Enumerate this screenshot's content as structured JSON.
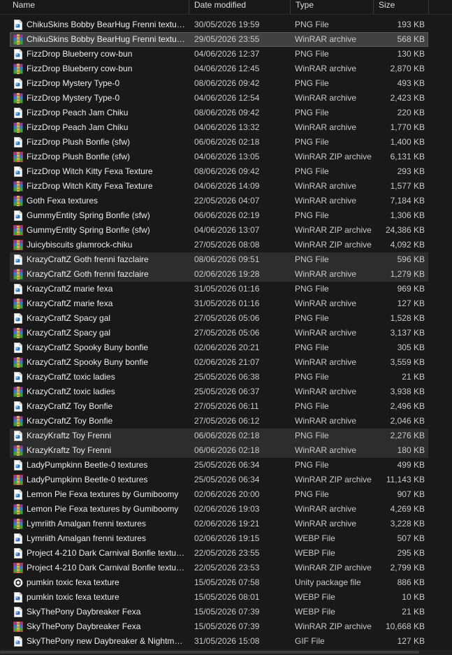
{
  "columns": {
    "name": "Name",
    "date": "Date modified",
    "type": "Type",
    "size": "Size"
  },
  "files": [
    {
      "name": "ChikuSkins Bobby BearHug Frenni textures",
      "date": "30/05/2026 19:59",
      "type": "PNG File",
      "size": "193 KB",
      "icon": "png-file-icon"
    },
    {
      "name": "ChikuSkins Bobby BearHug Frenni textures",
      "date": "29/05/2026 23:55",
      "type": "WinRAR archive",
      "size": "568 KB",
      "icon": "winrar-archive-icon"
    },
    {
      "name": "FizzDrop Blueberry cow-bun",
      "date": "04/06/2026 12:37",
      "type": "PNG File",
      "size": "130 KB",
      "icon": "png-file-icon"
    },
    {
      "name": "FizzDrop Blueberry cow-bun",
      "date": "04/06/2026 12:45",
      "type": "WinRAR archive",
      "size": "2,870 KB",
      "icon": "winrar-archive-icon"
    },
    {
      "name": "FizzDrop Mystery Type-0",
      "date": "08/06/2026 09:42",
      "type": "PNG File",
      "size": "493 KB",
      "icon": "png-file-icon"
    },
    {
      "name": "FizzDrop Mystery Type-0",
      "date": "04/06/2026 12:54",
      "type": "WinRAR archive",
      "size": "2,423 KB",
      "icon": "winrar-archive-icon"
    },
    {
      "name": "FizzDrop Peach Jam Chiku",
      "date": "08/06/2026 09:42",
      "type": "PNG File",
      "size": "220 KB",
      "icon": "png-file-icon"
    },
    {
      "name": "FizzDrop Peach Jam Chiku",
      "date": "04/06/2026 13:32",
      "type": "WinRAR archive",
      "size": "1,770 KB",
      "icon": "winrar-archive-icon"
    },
    {
      "name": "FizzDrop Plush Bonfie (sfw)",
      "date": "06/06/2026 02:18",
      "type": "PNG File",
      "size": "1,400 KB",
      "icon": "png-file-icon"
    },
    {
      "name": "FizzDrop Plush Bonfie (sfw)",
      "date": "04/06/2026 13:05",
      "type": "WinRAR ZIP archive",
      "size": "6,131 KB",
      "icon": "winrar-zip-archive-icon"
    },
    {
      "name": "FizzDrop Witch Kitty Fexa Texture",
      "date": "08/06/2026 09:42",
      "type": "PNG File",
      "size": "293 KB",
      "icon": "png-file-icon"
    },
    {
      "name": "FizzDrop Witch Kitty Fexa Texture",
      "date": "04/06/2026 14:09",
      "type": "WinRAR archive",
      "size": "1,577 KB",
      "icon": "winrar-archive-icon"
    },
    {
      "name": "Goth Fexa textures",
      "date": "22/05/2026 04:07",
      "type": "WinRAR archive",
      "size": "7,184 KB",
      "icon": "winrar-archive-icon"
    },
    {
      "name": "GummyEntity Spring Bonfie (sfw)",
      "date": "06/06/2026 02:19",
      "type": "PNG File",
      "size": "1,306 KB",
      "icon": "png-file-icon"
    },
    {
      "name": "GummyEntity Spring Bonfie (sfw)",
      "date": "04/06/2026 13:07",
      "type": "WinRAR ZIP archive",
      "size": "24,386 KB",
      "icon": "winrar-zip-archive-icon"
    },
    {
      "name": "Juicybiscuits glamrock-chiku",
      "date": "27/05/2026 08:08",
      "type": "WinRAR ZIP archive",
      "size": "4,092 KB",
      "icon": "winrar-zip-archive-icon"
    },
    {
      "name": "KrazyCraftZ Goth frenni fazclaire",
      "date": "08/06/2026 09:51",
      "type": "PNG File",
      "size": "596 KB",
      "icon": "png-file-icon"
    },
    {
      "name": "KrazyCraftZ Goth frenni fazclaire",
      "date": "02/06/2026 19:28",
      "type": "WinRAR archive",
      "size": "1,279 KB",
      "icon": "winrar-archive-icon"
    },
    {
      "name": "KrazyCraftZ marie fexa",
      "date": "31/05/2026 01:16",
      "type": "PNG File",
      "size": "969 KB",
      "icon": "png-file-icon"
    },
    {
      "name": "KrazyCraftZ marie fexa",
      "date": "31/05/2026 01:16",
      "type": "WinRAR archive",
      "size": "127 KB",
      "icon": "winrar-archive-icon"
    },
    {
      "name": "KrazyCraftZ Spacy gal",
      "date": "27/05/2026 05:06",
      "type": "PNG File",
      "size": "1,528 KB",
      "icon": "png-file-icon"
    },
    {
      "name": "KrazyCraftZ Spacy gal",
      "date": "27/05/2026 05:06",
      "type": "WinRAR archive",
      "size": "3,137 KB",
      "icon": "winrar-archive-icon"
    },
    {
      "name": "KrazyCraftZ Spooky Buny bonfie",
      "date": "02/06/2026 20:21",
      "type": "PNG File",
      "size": "305 KB",
      "icon": "png-file-icon"
    },
    {
      "name": "KrazyCraftZ Spooky Buny bonfie",
      "date": "02/06/2026 21:07",
      "type": "WinRAR archive",
      "size": "3,559 KB",
      "icon": "winrar-archive-icon"
    },
    {
      "name": "KrazyCraftZ toxic ladies",
      "date": "25/05/2026 06:38",
      "type": "PNG File",
      "size": "21 KB",
      "icon": "png-file-icon"
    },
    {
      "name": "KrazyCraftZ toxic ladies",
      "date": "25/05/2026 06:37",
      "type": "WinRAR archive",
      "size": "3,938 KB",
      "icon": "winrar-archive-icon"
    },
    {
      "name": "KrazyCraftZ Toy Bonfie",
      "date": "27/05/2026 06:11",
      "type": "PNG File",
      "size": "2,496 KB",
      "icon": "png-file-icon"
    },
    {
      "name": "KrazyCraftZ Toy Bonfie",
      "date": "27/05/2026 06:12",
      "type": "WinRAR archive",
      "size": "2,046 KB",
      "icon": "winrar-archive-icon"
    },
    {
      "name": "KrazyKraftz Toy Frenni",
      "date": "06/06/2026 02:18",
      "type": "PNG File",
      "size": "2,276 KB",
      "icon": "png-file-icon"
    },
    {
      "name": "KrazyKraftz Toy Frenni",
      "date": "06/06/2026 02:18",
      "type": "WinRAR archive",
      "size": "180 KB",
      "icon": "winrar-archive-icon"
    },
    {
      "name": "LadyPumpkinn Beetle-0 textures",
      "date": "25/05/2026 06:34",
      "type": "PNG File",
      "size": "499 KB",
      "icon": "png-file-icon"
    },
    {
      "name": "LadyPumpkinn Beetle-0 textures",
      "date": "25/05/2026 06:34",
      "type": "WinRAR ZIP archive",
      "size": "11,143 KB",
      "icon": "winrar-zip-archive-icon"
    },
    {
      "name": "Lemon Pie Fexa textures by Gumiboomy",
      "date": "02/06/2026 20:00",
      "type": "PNG File",
      "size": "907 KB",
      "icon": "png-file-icon"
    },
    {
      "name": "Lemon Pie Fexa textures by Gumiboomy",
      "date": "02/06/2026 19:03",
      "type": "WinRAR archive",
      "size": "4,269 KB",
      "icon": "winrar-archive-icon"
    },
    {
      "name": "Lymriith Amalgan frenni textures",
      "date": "02/06/2026 19:21",
      "type": "WinRAR archive",
      "size": "3,228 KB",
      "icon": "winrar-archive-icon"
    },
    {
      "name": "Lymriith Amalgan frenni textures",
      "date": "02/06/2026 19:15",
      "type": "WEBP File",
      "size": "507 KB",
      "icon": "webp-file-icon"
    },
    {
      "name": "Project 4-210 Dark Carnival Bonfie textures",
      "date": "22/05/2026 23:55",
      "type": "WEBP File",
      "size": "295 KB",
      "icon": "webp-file-icon"
    },
    {
      "name": "Project 4-210 Dark Carnival Bonfie textures",
      "date": "22/05/2026 23:53",
      "type": "WinRAR ZIP archive",
      "size": "2,799 KB",
      "icon": "winrar-zip-archive-icon"
    },
    {
      "name": "pumkin toxic fexa texture",
      "date": "15/05/2026 07:58",
      "type": "Unity package file",
      "size": "886 KB",
      "icon": "unity-package-icon"
    },
    {
      "name": "pumkin toxic fexa texture",
      "date": "15/05/2026 08:01",
      "type": "WEBP File",
      "size": "10 KB",
      "icon": "webp-file-icon"
    },
    {
      "name": "SkyThePony Daybreaker Fexa",
      "date": "15/05/2026 07:39",
      "type": "WEBP File",
      "size": "21 KB",
      "icon": "webp-file-icon"
    },
    {
      "name": "SkyThePony Daybreaker Fexa",
      "date": "15/05/2026 07:39",
      "type": "WinRAR ZIP archive",
      "size": "10,668 KB",
      "icon": "winrar-zip-archive-icon"
    },
    {
      "name": "SkyThePony new Daybreaker & Nightma...",
      "date": "31/05/2026 15:08",
      "type": "GIF File",
      "size": "127 KB",
      "icon": "gif-file-icon"
    }
  ]
}
